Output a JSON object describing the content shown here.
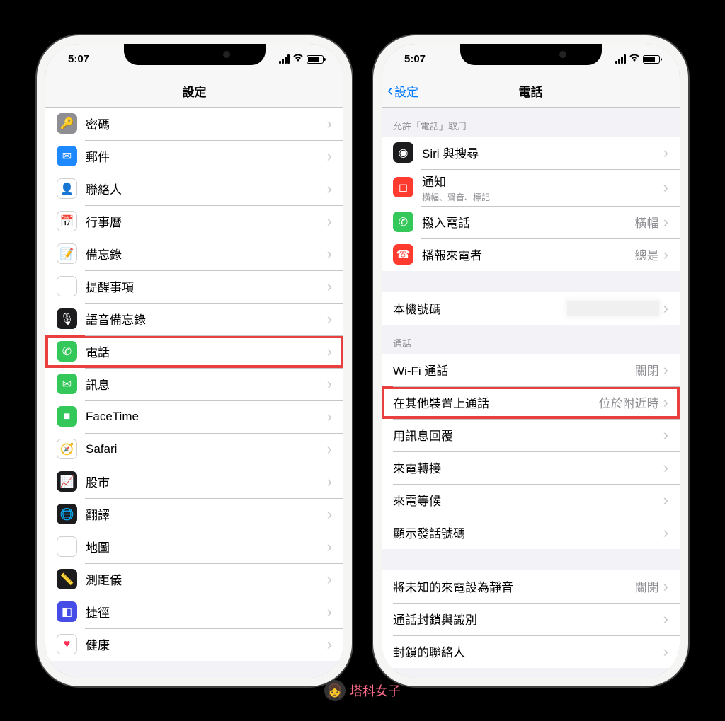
{
  "status": {
    "time": "5:07"
  },
  "phones": {
    "left": {
      "nav_title": "設定",
      "items": [
        {
          "id": "passwords",
          "label": "密碼",
          "bg": "#8e8e93",
          "glyph": "🔑"
        },
        {
          "id": "mail",
          "label": "郵件",
          "bg": "#1e88ff",
          "glyph": "✉"
        },
        {
          "id": "contacts",
          "label": "聯絡人",
          "bg": "#ffffff",
          "glyph": "👤",
          "border": true
        },
        {
          "id": "calendar",
          "label": "行事曆",
          "bg": "#ffffff",
          "glyph": "📅",
          "border": true
        },
        {
          "id": "notes",
          "label": "備忘錄",
          "bg": "#ffffff",
          "glyph": "📝",
          "border": true
        },
        {
          "id": "reminders",
          "label": "提醒事項",
          "bg": "#ffffff",
          "glyph": "⦿",
          "border": true
        },
        {
          "id": "voice-memos",
          "label": "語音備忘錄",
          "bg": "#1c1c1e",
          "glyph": "🎙"
        },
        {
          "id": "phone",
          "label": "電話",
          "bg": "#34c759",
          "glyph": "✆",
          "highlight": true
        },
        {
          "id": "messages",
          "label": "訊息",
          "bg": "#34c759",
          "glyph": "✉"
        },
        {
          "id": "facetime",
          "label": "FaceTime",
          "bg": "#34c759",
          "glyph": "■"
        },
        {
          "id": "safari",
          "label": "Safari",
          "bg": "#ffffff",
          "glyph": "🧭",
          "border": true
        },
        {
          "id": "stocks",
          "label": "股市",
          "bg": "#1c1c1e",
          "glyph": "📈"
        },
        {
          "id": "translate",
          "label": "翻譯",
          "bg": "#1c1c1e",
          "glyph": "🌐"
        },
        {
          "id": "maps",
          "label": "地圖",
          "bg": "#ffffff",
          "glyph": "🗺",
          "border": true
        },
        {
          "id": "measure",
          "label": "測距儀",
          "bg": "#1c1c1e",
          "glyph": "📏"
        },
        {
          "id": "shortcuts",
          "label": "捷徑",
          "bg": "#454de6",
          "glyph": "◧"
        },
        {
          "id": "health",
          "label": "健康",
          "bg": "#ffffff",
          "glyph": "♥",
          "border": true,
          "color": "#ff2d55"
        }
      ]
    },
    "right": {
      "nav_title": "電話",
      "nav_back": "設定",
      "groups": [
        {
          "header": "允許「電話」取用",
          "items": [
            {
              "id": "siri",
              "label": "Siri 與搜尋",
              "bg": "#1c1c1e",
              "glyph": "◉",
              "icon": true
            },
            {
              "id": "notifications",
              "label": "通知",
              "sub": "橫幅、聲音、標記",
              "bg": "#ff3b30",
              "glyph": "◻",
              "icon": true
            },
            {
              "id": "incoming",
              "label": "撥入電話",
              "value": "橫幅",
              "bg": "#34c759",
              "glyph": "✆",
              "icon": true
            },
            {
              "id": "announce",
              "label": "播報來電者",
              "value": "總是",
              "bg": "#ff3b30",
              "glyph": "☎",
              "icon": true
            }
          ]
        },
        {
          "items": [
            {
              "id": "my-number",
              "label": "本機號碼",
              "redacted": true
            }
          ]
        },
        {
          "header": "通話",
          "items": [
            {
              "id": "wifi-call",
              "label": "Wi-Fi 通話",
              "value": "關閉"
            },
            {
              "id": "other-devices",
              "label": "在其他裝置上通話",
              "value": "位於附近時",
              "highlight": true
            },
            {
              "id": "respond-text",
              "label": "用訊息回覆"
            },
            {
              "id": "call-forward",
              "label": "來電轉接"
            },
            {
              "id": "call-waiting",
              "label": "來電等候"
            },
            {
              "id": "caller-id",
              "label": "顯示發話號碼"
            }
          ]
        },
        {
          "items": [
            {
              "id": "silence-unknown",
              "label": "將未知的來電設為靜音",
              "value": "關閉"
            },
            {
              "id": "blocking",
              "label": "通話封鎖與識別"
            },
            {
              "id": "blocked-contacts",
              "label": "封鎖的聯絡人"
            }
          ]
        }
      ]
    }
  },
  "watermark": "塔科女子"
}
